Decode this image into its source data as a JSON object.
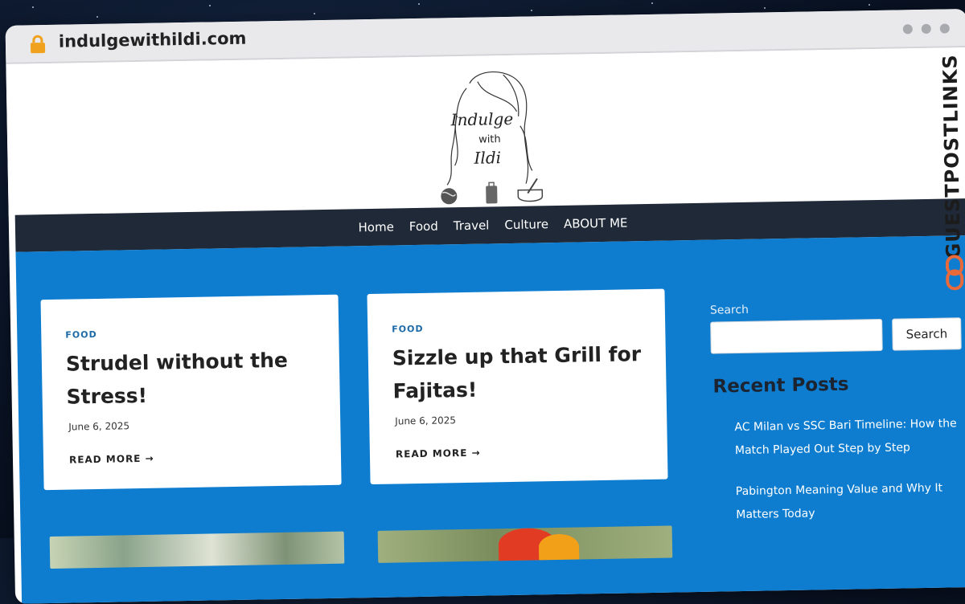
{
  "browser": {
    "url": "indulgewithildi.com"
  },
  "logo": {
    "line1": "Indulge",
    "line2": "with",
    "line3": "Ildi"
  },
  "nav": {
    "items": [
      "Home",
      "Food",
      "Travel",
      "Culture",
      "ABOUT ME"
    ]
  },
  "posts": [
    {
      "category": "FOOD",
      "title": "Strudel without the Stress!",
      "date": "June 6, 2025",
      "read_more": "READ MORE →"
    },
    {
      "category": "FOOD",
      "title": "Sizzle up that Grill for Fajitas!",
      "date": "June 6, 2025",
      "read_more": "READ MORE →"
    }
  ],
  "sidebar": {
    "search_label": "Search",
    "search_button": "Search",
    "recent_heading": "Recent Posts",
    "recent_posts": [
      "AC Milan vs SSC Bari Timeline: How the Match Played Out Step by Step",
      "Pabington Meaning Value and Why It Matters Today"
    ]
  },
  "watermark": {
    "text": "GUESTPOSTLINKS"
  },
  "colors": {
    "nav_bg": "#1f2937",
    "content_bg": "#0f7dcf",
    "accent": "#1e6aa6",
    "lock": "#f0a21f",
    "watermark_icon": "#e8693a"
  }
}
